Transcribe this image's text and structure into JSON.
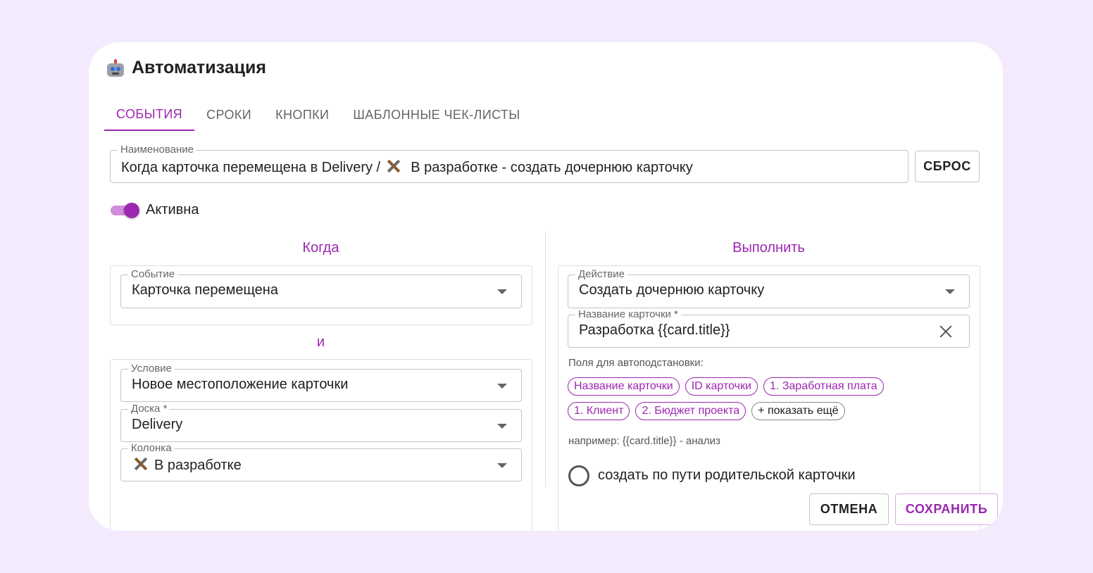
{
  "dialog": {
    "title": "Автоматизация",
    "title_icon": "robot-icon"
  },
  "tabs": [
    {
      "label": "СОБЫТИЯ",
      "active": true
    },
    {
      "label": "СРОКИ",
      "active": false
    },
    {
      "label": "КНОПКИ",
      "active": false
    },
    {
      "label": "ШАБЛОННЫЕ ЧЕК-ЛИСТЫ",
      "active": false
    }
  ],
  "name_field": {
    "label": "Наименование",
    "value_prefix": "Когда карточка перемещена в Delivery / ",
    "value_icon": "tools-icon",
    "value_suffix": " В разработке - создать дочернюю карточку"
  },
  "reset_button": "СБРОС",
  "active_toggle": {
    "label": "Активна",
    "checked": true
  },
  "when": {
    "heading": "Когда",
    "event": {
      "label": "Событие",
      "value": "Карточка перемещена"
    },
    "and_label": "и",
    "condition": {
      "label": "Условие",
      "value": "Новое местоположение карточки"
    },
    "board": {
      "label": "Доска *",
      "value": "Delivery"
    },
    "column": {
      "label": "Колонка",
      "value": "В разработке",
      "icon": "tools-icon"
    }
  },
  "execute": {
    "heading": "Выполнить",
    "action": {
      "label": "Действие",
      "value": "Создать дочернюю карточку"
    },
    "card_name": {
      "label": "Название карточки *",
      "value": "Разработка {{card.title}}"
    },
    "autofill_label": "Поля для автоподстановки:",
    "chips_row1": [
      "Название карточки",
      "ID карточки",
      "1. Заработная плата"
    ],
    "chips_row2": [
      "1. Клиент",
      "2. Бюджет проекта"
    ],
    "show_more": "+ показать ещё",
    "example": "например: {{card.title}} - анализ",
    "radio_label": "создать по пути родительской карточки"
  },
  "footer": {
    "cancel": "ОТМЕНА",
    "save": "СОХРАНИТЬ"
  },
  "colors": {
    "accent": "#9c27b0",
    "background": "#f3ebfd"
  }
}
